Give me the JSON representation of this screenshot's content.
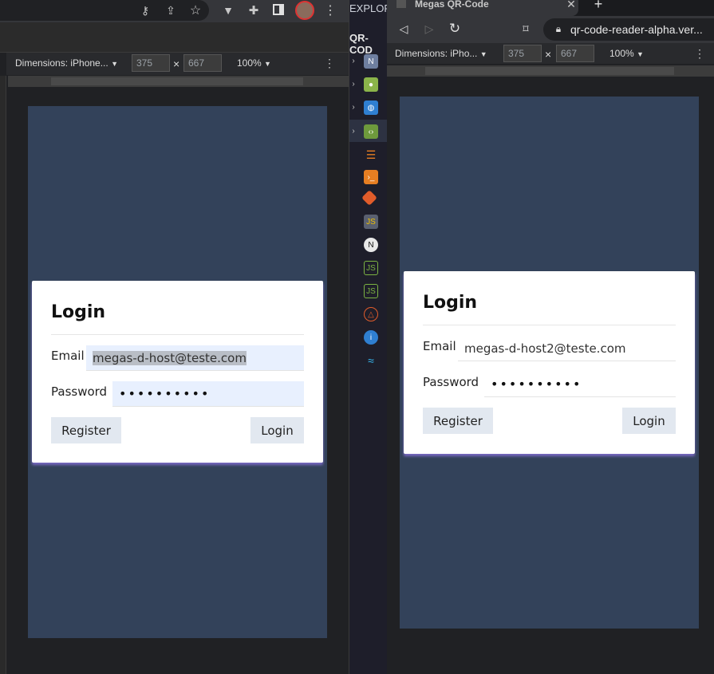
{
  "left_window": {
    "toolbar": {
      "dimensions_label": "Dimensions: iPhone...",
      "width": "375",
      "height": "667",
      "zoom": "100%",
      "times": "×"
    },
    "login": {
      "title": "Login",
      "email_label": "Email",
      "email_value": "megas-d-host@teste.com",
      "password_label": "Password",
      "password_value": "••••••••••",
      "register_label": "Register",
      "login_label": "Login"
    }
  },
  "explorer": {
    "title": "EXPLOR",
    "folder": "QR-COD"
  },
  "right_window": {
    "tab_title": "Megas QR-Code",
    "address": "qr-code-reader-alpha.ver...",
    "toolbar": {
      "dimensions_label": "Dimensions: iPho...",
      "width": "375",
      "height": "667",
      "zoom": "100%",
      "times": "×"
    },
    "login": {
      "title": "Login",
      "email_label": "Email",
      "email_value": "megas-d-host2@teste.com",
      "password_label": "Password",
      "password_value": "••••••••••",
      "register_label": "Register",
      "login_label": "Login"
    }
  },
  "colors": {
    "viewport_bg": "#33425a",
    "card_shadow": "#826ed2",
    "autofill_bg": "#e8f0fe",
    "button_bg": "#e2e8f0"
  }
}
